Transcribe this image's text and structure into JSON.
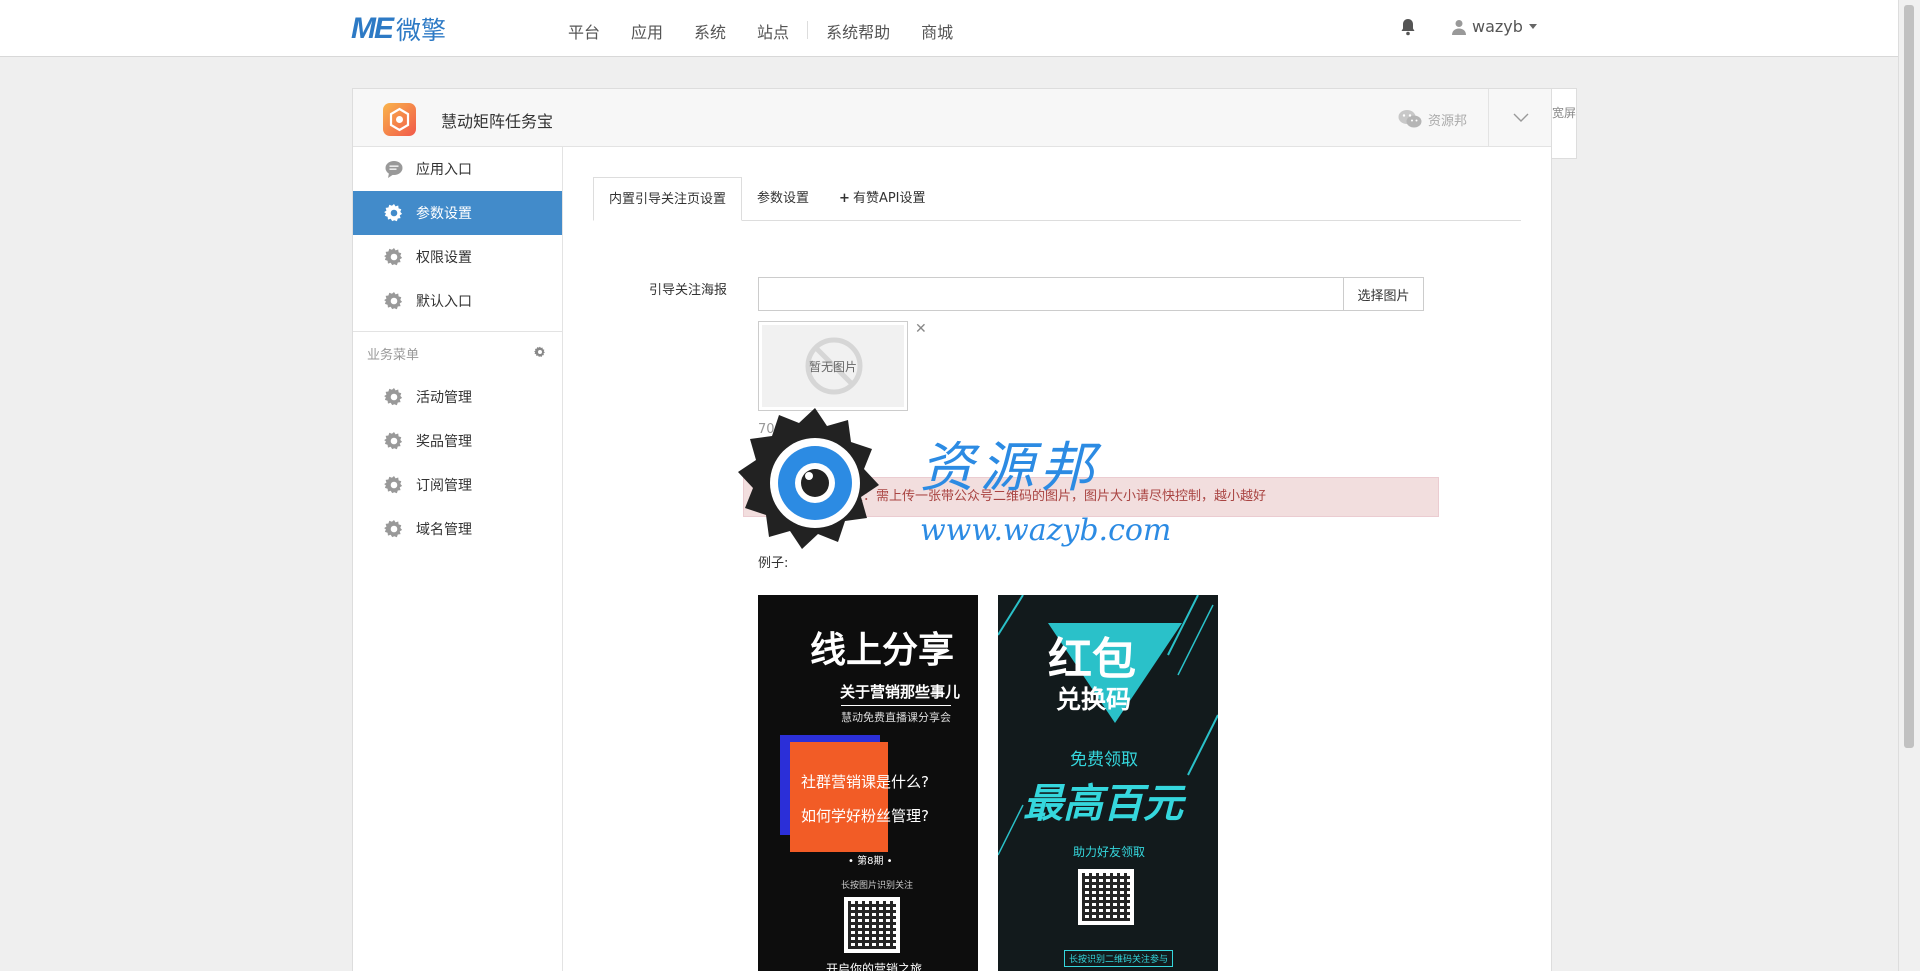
{
  "topbar": {
    "logo_mark": "ME",
    "logo_text": "微擎",
    "nav": [
      "平台",
      "应用",
      "系统",
      "站点",
      "系统帮助",
      "商城"
    ],
    "user_name": "wazyb"
  },
  "app": {
    "title": "慧动矩阵任务宝",
    "sponsor": "资源邦",
    "wide_label": "宽屏"
  },
  "sidebar": {
    "items": [
      {
        "label": "应用入口",
        "icon": "chat-icon",
        "active": false
      },
      {
        "label": "参数设置",
        "icon": "gear-icon",
        "active": true
      },
      {
        "label": "权限设置",
        "icon": "gear-icon",
        "active": false
      },
      {
        "label": "默认入口",
        "icon": "gear-icon",
        "active": false
      }
    ],
    "section_title": "业务菜单",
    "section_items": [
      {
        "label": "活动管理",
        "icon": "gear-icon"
      },
      {
        "label": "奖品管理",
        "icon": "gear-icon"
      },
      {
        "label": "订阅管理",
        "icon": "gear-icon"
      },
      {
        "label": "域名管理",
        "icon": "gear-icon"
      }
    ]
  },
  "tabs": [
    {
      "label": "内置引导关注页设置",
      "active": true
    },
    {
      "label": "参数设置",
      "active": false
    },
    {
      "label": "有赞API设置",
      "active": false,
      "prefix": "+"
    }
  ],
  "form": {
    "poster_label": "引导关注海报",
    "poster_value": "",
    "choose_button": "选择图片",
    "no_image": "暂无图片",
    "size_hint": "700*1108",
    "alert": "内置引导页面设置：需上传一张带公众号二维码的图片，图片大小请尽快控制，越小越好",
    "example_label": "例子:"
  },
  "examples": {
    "poster1": {
      "title": "线上分享",
      "subtitle": "关于营销那些事儿",
      "subtitle2": "慧动免费直播课分享会",
      "question1": "社群营销课是什么?",
      "question2": "如何学好粉丝管理?",
      "issue": "• 第8期 •",
      "scan": "长按图片识别关注",
      "footer": "开启你的营销之旅"
    },
    "poster2": {
      "title": "红包",
      "title2": "兑换码",
      "free": "免费领取",
      "big": "最高百元",
      "help": "助力好友领取",
      "footer": "长按识别二维码关注参与"
    }
  },
  "watermark": {
    "cn": "资源邦",
    "url": "www.wazyb.com"
  },
  "colors": {
    "primary": "#428bca",
    "logo": "#2d7ac5",
    "alert_bg": "#f2dede",
    "alert_text": "#a94442"
  }
}
